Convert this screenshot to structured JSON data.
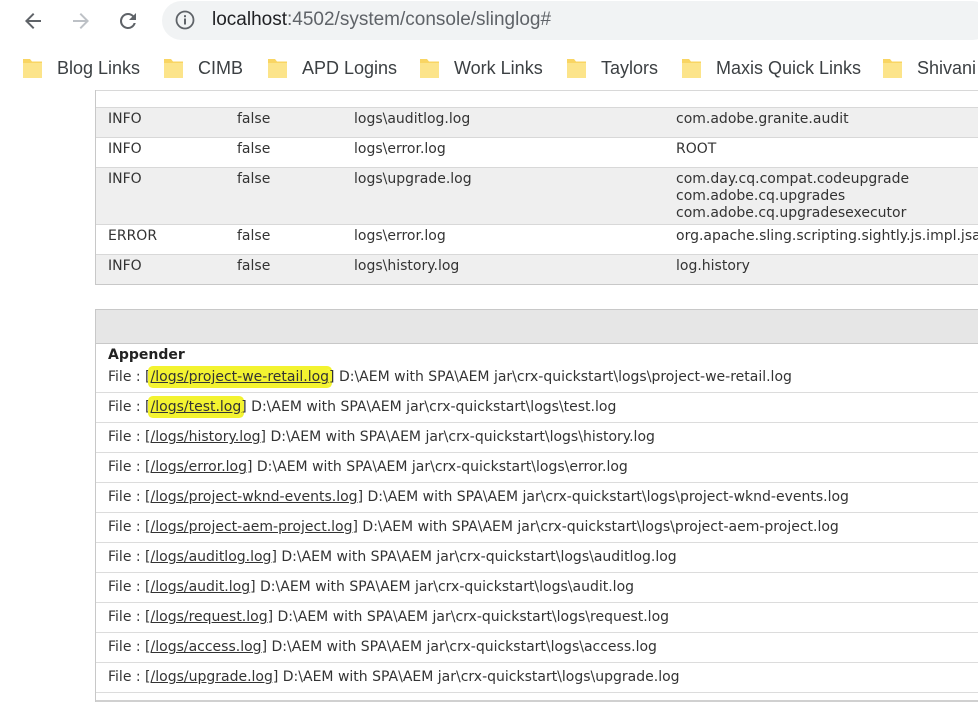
{
  "browser": {
    "url_host": "localhost",
    "url_path": ":4502/system/console/slinglog#",
    "icons": [
      "back-arrow-icon",
      "forward-arrow-icon",
      "reload-icon",
      "info-icon",
      "folder-icon"
    ]
  },
  "bookmarks": [
    {
      "label": "Blog Links"
    },
    {
      "label": "CIMB"
    },
    {
      "label": "APD Logins"
    },
    {
      "label": "Work Links"
    },
    {
      "label": "Taylors"
    },
    {
      "label": "Maxis Quick Links"
    },
    {
      "label": "Shivani"
    }
  ],
  "loggers": [
    {
      "level": "INFO",
      "additive": "false",
      "file": "logs\\auditlog.log",
      "logger": [
        "com.adobe.granite.audit"
      ]
    },
    {
      "level": "INFO",
      "additive": "false",
      "file": "logs\\error.log",
      "logger": [
        "ROOT"
      ]
    },
    {
      "level": "INFO",
      "additive": "false",
      "file": "logs\\upgrade.log",
      "logger": [
        "com.day.cq.compat.codeupgrade",
        "com.adobe.cq.upgrades",
        "com.adobe.cq.upgradesexecutor"
      ]
    },
    {
      "level": "ERROR",
      "additive": "false",
      "file": "logs\\error.log",
      "logger": [
        "org.apache.sling.scripting.sightly.js.impl.jsapi.ProxyAsyncScriptableFactory"
      ]
    },
    {
      "level": "INFO",
      "additive": "false",
      "file": "logs\\history.log",
      "logger": [
        "log.history"
      ]
    }
  ],
  "appenders": {
    "header": "Appender",
    "prefix": "File : [",
    "rows": [
      {
        "link": "/logs/project-we-retail.log",
        "path": "] D:\\AEM with SPA\\AEM jar\\crx-quickstart\\logs\\project-we-retail.log"
      },
      {
        "link": "/logs/test.log",
        "path": "] D:\\AEM with SPA\\AEM jar\\crx-quickstart\\logs\\test.log"
      },
      {
        "link": "/logs/history.log",
        "path": "] D:\\AEM with SPA\\AEM jar\\crx-quickstart\\logs\\history.log"
      },
      {
        "link": "/logs/error.log",
        "path": "] D:\\AEM with SPA\\AEM jar\\crx-quickstart\\logs\\error.log"
      },
      {
        "link": "/logs/project-wknd-events.log",
        "path": "] D:\\AEM with SPA\\AEM jar\\crx-quickstart\\logs\\project-wknd-events.log"
      },
      {
        "link": "/logs/project-aem-project.log",
        "path": "] D:\\AEM with SPA\\AEM jar\\crx-quickstart\\logs\\project-aem-project.log"
      },
      {
        "link": "/logs/auditlog.log",
        "path": "] D:\\AEM with SPA\\AEM jar\\crx-quickstart\\logs\\auditlog.log"
      },
      {
        "link": "/logs/audit.log",
        "path": "] D:\\AEM with SPA\\AEM jar\\crx-quickstart\\logs\\audit.log"
      },
      {
        "link": "/logs/request.log",
        "path": "] D:\\AEM with SPA\\AEM jar\\crx-quickstart\\logs\\request.log"
      },
      {
        "link": "/logs/access.log",
        "path": "] D:\\AEM with SPA\\AEM jar\\crx-quickstart\\logs\\access.log"
      },
      {
        "link": "/logs/upgrade.log",
        "path": "] D:\\AEM with SPA\\AEM jar\\crx-quickstart\\logs\\upgrade.log"
      }
    ]
  },
  "colors": {
    "highlight": "#f3f330",
    "row_alt": "#efefef",
    "omnibox": "#f1f3f4",
    "folder": "#f9d563"
  }
}
